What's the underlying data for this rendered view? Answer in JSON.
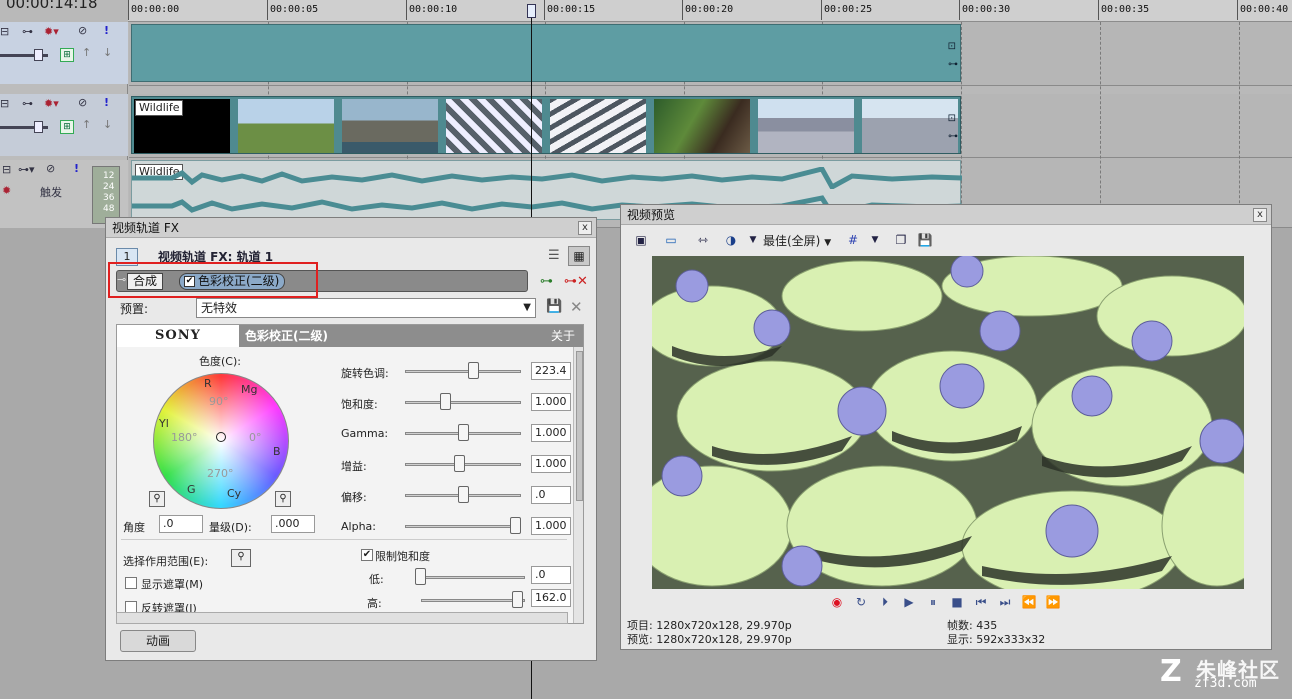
{
  "timeline": {
    "time_readout": "00:00:14:18",
    "ruler_ticks": [
      "00:00:00",
      "00:00:05",
      "00:00:10",
      "00:00:15",
      "00:00:20",
      "00:00:25",
      "00:00:30",
      "00:00:35",
      "00:00:40"
    ],
    "clip_video_label": "Wildlife",
    "clip_audio_label": "Wildlife",
    "audio_header": {
      "trigger_label": "触发",
      "meter_labels": [
        "12",
        "24",
        "36",
        "48"
      ]
    }
  },
  "fx_window": {
    "title": "视频轨道 FX",
    "close": "x",
    "track_number": "1",
    "header_text": "视频轨道 FX: 轨道 1",
    "chain": {
      "compose_label": "合成",
      "plugin_label": "色彩校正(二级)"
    },
    "preset_label": "预置:",
    "preset_value": "无特效",
    "plugin": {
      "logo": "SONY",
      "name": "色彩校正(二级)",
      "about": "关于",
      "color_label": "色度(C):",
      "wheel_labels": {
        "R": "R",
        "Mg": "Mg",
        "B": "B",
        "Cy": "Cy",
        "G": "G",
        "Yl": "Yl",
        "d90": "90°",
        "d180": "180°",
        "d0": "0°",
        "d270": "270°"
      },
      "angle_label": "角度",
      "angle_value": ".0",
      "magnitude_label": "量级(D):",
      "magnitude_value": ".000",
      "sliders": [
        {
          "label": "旋转色调:",
          "value": "223.4",
          "level": 0.6
        },
        {
          "label": "饱和度:",
          "value": "1.000",
          "level": 0.33
        },
        {
          "label": "Gamma:",
          "value": "1.000",
          "level": 0.5
        },
        {
          "label": "增益:",
          "value": "1.000",
          "level": 0.47
        },
        {
          "label": "偏移:",
          "value": ".0",
          "level": 0.5
        },
        {
          "label": "Alpha:",
          "value": "1.000",
          "level": 1.0
        }
      ],
      "select_range_label": "选择作用范围(E):",
      "show_mask_label": "显示遮罩(M)",
      "invert_mask_label": "反转遮罩(I)",
      "limit_saturation_label": "限制饱和度",
      "limit_low_label": "低:",
      "limit_low_value": ".0",
      "limit_high_label": "高:",
      "limit_high_value": "162.0",
      "limit_low_level": 0.0,
      "limit_high_level": 0.98
    },
    "animate_label": "动画"
  },
  "preview_window": {
    "title": "视频预览",
    "close": "x",
    "quality_label": "最佳(全屏)",
    "info": {
      "project": "项目: 1280x720x128, 29.970p",
      "preview": "预览: 1280x720x128, 29.970p",
      "frames": "帧数: 435",
      "display": "显示: 592x333x32"
    }
  },
  "watermark": {
    "text": "朱峰社区",
    "url": "zf3d.com"
  },
  "colors": {
    "highlight_red": "#e02020",
    "clip_teal": "#5e9da3",
    "chain_selected": "#8ba9c8"
  }
}
